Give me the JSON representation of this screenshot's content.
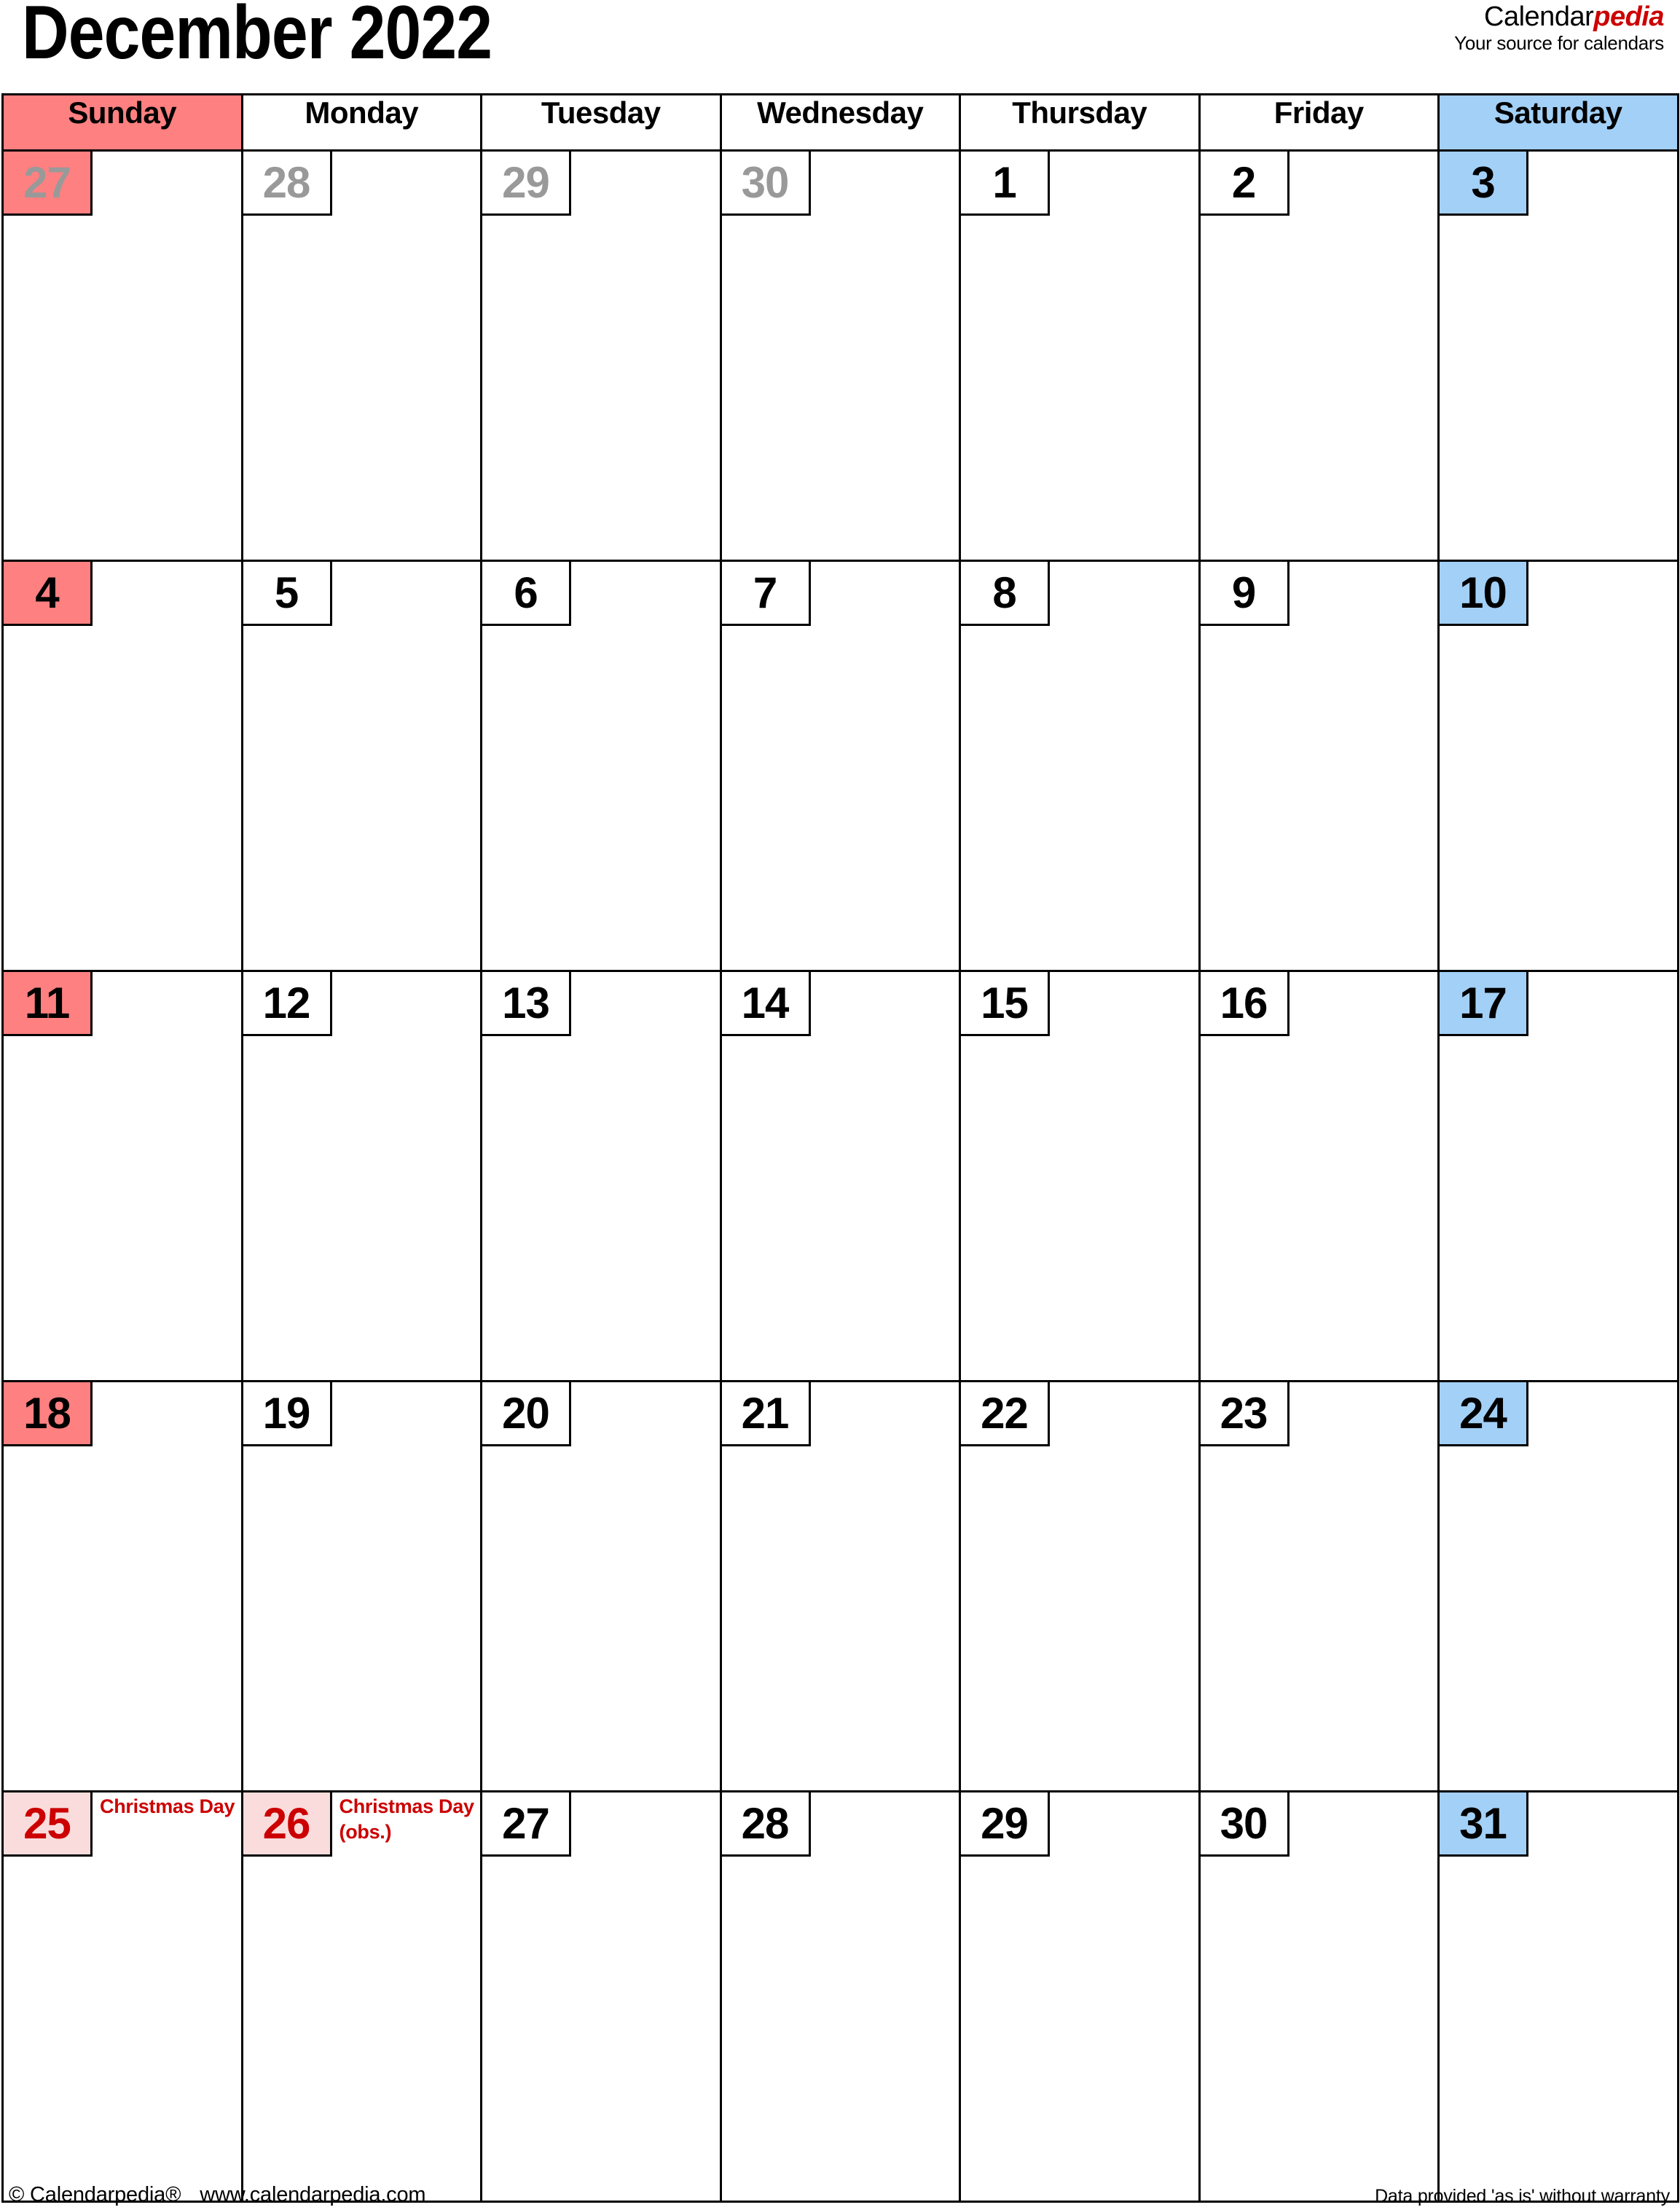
{
  "header": {
    "month_title": "December 2022",
    "brand_name_plain": "Calendar",
    "brand_name_accent": "pedia",
    "brand_tagline": "Your source for calendars",
    "accent_color": "#cc0000"
  },
  "colors": {
    "sunday_highlight": "#ff8080",
    "saturday_highlight": "#a3d0f7",
    "holiday_cell": "#fadcdc",
    "holiday_text": "#cc0000",
    "muted_day": "#999999",
    "grid_line": "#000000"
  },
  "weekdays": [
    {
      "label": "Sunday",
      "style": "sun"
    },
    {
      "label": "Monday",
      "style": "plain"
    },
    {
      "label": "Tuesday",
      "style": "plain"
    },
    {
      "label": "Wednesday",
      "style": "plain"
    },
    {
      "label": "Thursday",
      "style": "plain"
    },
    {
      "label": "Friday",
      "style": "plain"
    },
    {
      "label": "Saturday",
      "style": "sat"
    }
  ],
  "weeks": [
    [
      {
        "day": "27",
        "muted": true,
        "style": "sun",
        "events": []
      },
      {
        "day": "28",
        "muted": true,
        "style": "plain",
        "events": []
      },
      {
        "day": "29",
        "muted": true,
        "style": "plain",
        "events": []
      },
      {
        "day": "30",
        "muted": true,
        "style": "plain",
        "events": []
      },
      {
        "day": "1",
        "muted": false,
        "style": "plain",
        "events": []
      },
      {
        "day": "2",
        "muted": false,
        "style": "plain",
        "events": []
      },
      {
        "day": "3",
        "muted": false,
        "style": "sat",
        "events": []
      }
    ],
    [
      {
        "day": "4",
        "muted": false,
        "style": "sun",
        "events": []
      },
      {
        "day": "5",
        "muted": false,
        "style": "plain",
        "events": []
      },
      {
        "day": "6",
        "muted": false,
        "style": "plain",
        "events": []
      },
      {
        "day": "7",
        "muted": false,
        "style": "plain",
        "events": []
      },
      {
        "day": "8",
        "muted": false,
        "style": "plain",
        "events": []
      },
      {
        "day": "9",
        "muted": false,
        "style": "plain",
        "events": []
      },
      {
        "day": "10",
        "muted": false,
        "style": "sat",
        "events": []
      }
    ],
    [
      {
        "day": "11",
        "muted": false,
        "style": "sun",
        "events": []
      },
      {
        "day": "12",
        "muted": false,
        "style": "plain",
        "events": []
      },
      {
        "day": "13",
        "muted": false,
        "style": "plain",
        "events": []
      },
      {
        "day": "14",
        "muted": false,
        "style": "plain",
        "events": []
      },
      {
        "day": "15",
        "muted": false,
        "style": "plain",
        "events": []
      },
      {
        "day": "16",
        "muted": false,
        "style": "plain",
        "events": []
      },
      {
        "day": "17",
        "muted": false,
        "style": "sat",
        "events": []
      }
    ],
    [
      {
        "day": "18",
        "muted": false,
        "style": "sun",
        "events": []
      },
      {
        "day": "19",
        "muted": false,
        "style": "plain",
        "events": []
      },
      {
        "day": "20",
        "muted": false,
        "style": "plain",
        "events": []
      },
      {
        "day": "21",
        "muted": false,
        "style": "plain",
        "events": []
      },
      {
        "day": "22",
        "muted": false,
        "style": "plain",
        "events": []
      },
      {
        "day": "23",
        "muted": false,
        "style": "plain",
        "events": []
      },
      {
        "day": "24",
        "muted": false,
        "style": "sat",
        "events": []
      }
    ],
    [
      {
        "day": "25",
        "muted": false,
        "style": "holiday",
        "events": [
          "Christmas Day"
        ]
      },
      {
        "day": "26",
        "muted": false,
        "style": "holiday",
        "events": [
          "Christmas Day (obs.)"
        ]
      },
      {
        "day": "27",
        "muted": false,
        "style": "plain",
        "events": []
      },
      {
        "day": "28",
        "muted": false,
        "style": "plain",
        "events": []
      },
      {
        "day": "29",
        "muted": false,
        "style": "plain",
        "events": []
      },
      {
        "day": "30",
        "muted": false,
        "style": "plain",
        "events": []
      },
      {
        "day": "31",
        "muted": false,
        "style": "sat",
        "events": []
      }
    ]
  ],
  "footer": {
    "copyright": "© Calendarpedia®",
    "website": "www.calendarpedia.com",
    "disclaimer": "Data provided 'as is' without warranty"
  }
}
